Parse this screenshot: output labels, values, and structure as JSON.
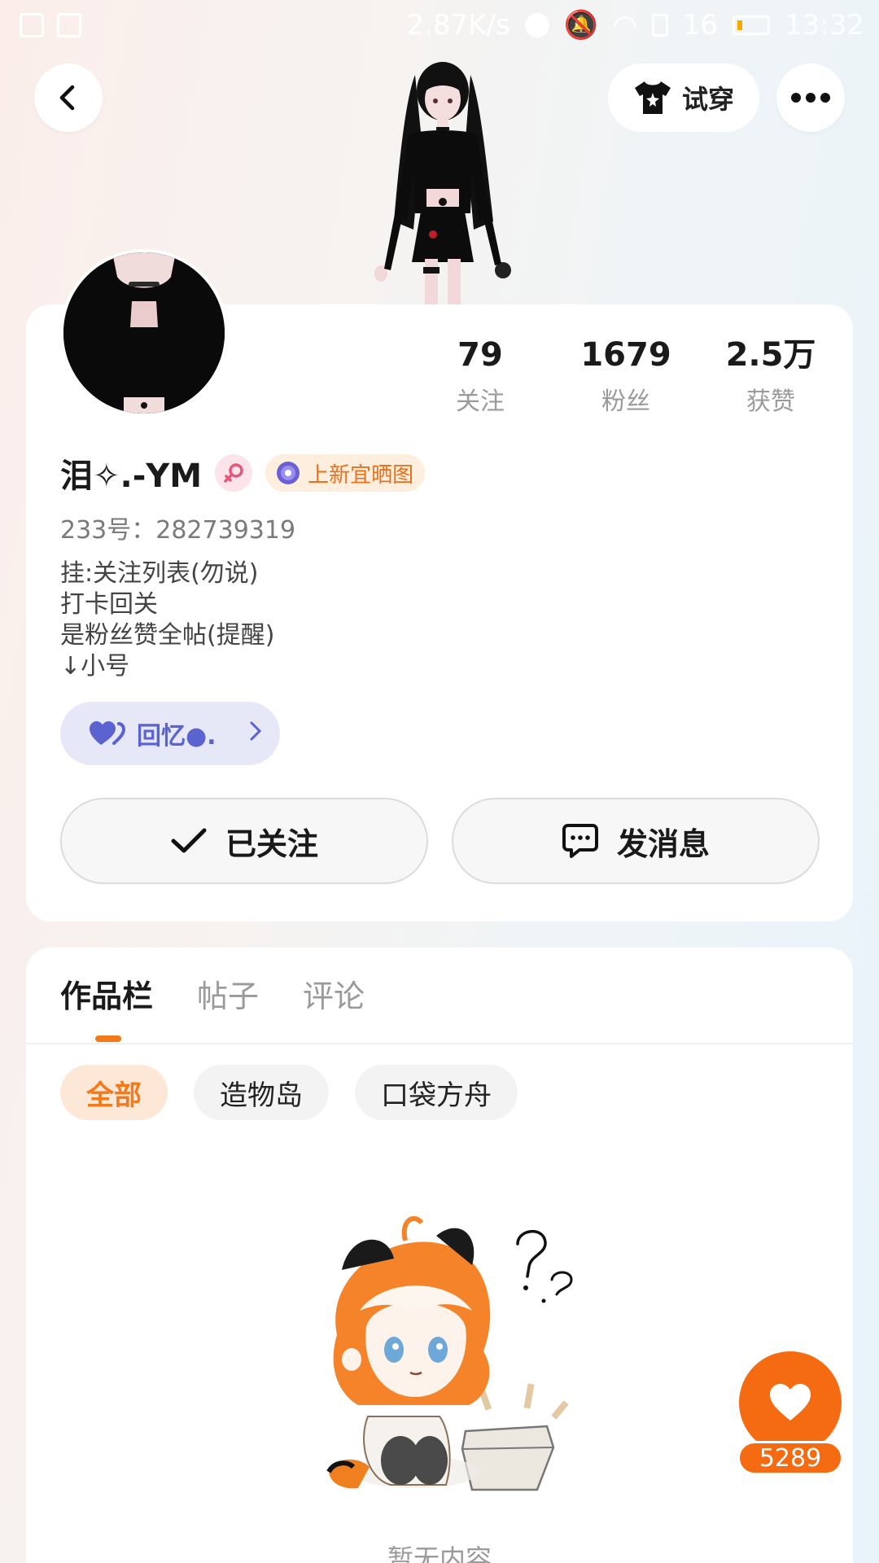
{
  "status_bar": {
    "network_speed": "2.87K/s",
    "signal": "16",
    "time": "13:32"
  },
  "top_bar": {
    "try_on_label": "试穿"
  },
  "stats": [
    {
      "value": "79",
      "label": "关注"
    },
    {
      "value": "1679",
      "label": "粉丝"
    },
    {
      "value": "2.5万",
      "label": "获赞"
    }
  ],
  "profile": {
    "username": "泪✧.-YM",
    "tag_label": "上新宜晒图",
    "uid": "233号：282739319",
    "bio": [
      "挂:关注列表(勿说)",
      "打卡回关",
      "是粉丝赞全帖(提醒)",
      "↓小号"
    ],
    "memory_chip_label": "回忆●."
  },
  "actions": {
    "follow_label": "已关注",
    "message_label": "发消息"
  },
  "tabs": [
    {
      "label": "作品栏",
      "active": true
    },
    {
      "label": "帖子",
      "active": false
    },
    {
      "label": "评论",
      "active": false
    }
  ],
  "filters": [
    {
      "label": "全部",
      "active": true
    },
    {
      "label": "造物岛",
      "active": false
    },
    {
      "label": "口袋方舟",
      "active": false
    }
  ],
  "empty_state": {
    "text": "暂无内容"
  },
  "like": {
    "count": "5289"
  },
  "colors": {
    "accent": "#f27a1a",
    "memory_chip": "#5a63cf"
  }
}
